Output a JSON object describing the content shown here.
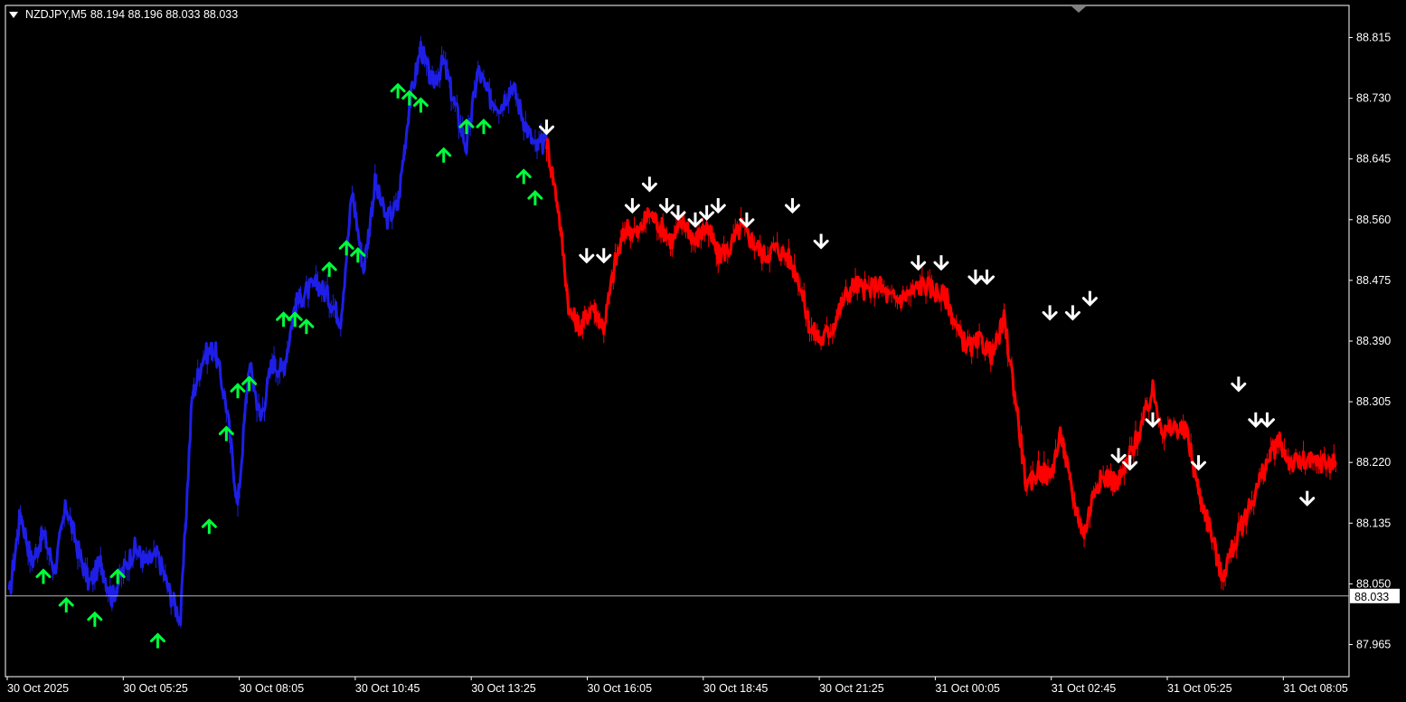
{
  "header": {
    "symbol": "NZDJPY,M5",
    "ohlc": "88.194 88.196 88.033 88.033"
  },
  "colors": {
    "background": "#000000",
    "axis": "#ffffff",
    "up_trend": "#1e1ee6",
    "down_trend": "#ff0000",
    "buy_arrow": "#00ff3c",
    "sell_arrow": "#ffffff",
    "price_line": "#b4b4b4"
  },
  "chart_data": {
    "type": "line",
    "ylim": [
      87.92,
      88.86
    ],
    "y_ticks": [
      "88.815",
      "88.730",
      "88.645",
      "88.560",
      "88.475",
      "88.390",
      "88.305",
      "88.220",
      "88.135",
      "88.050",
      "87.965"
    ],
    "x_ticks": [
      "30 Oct 2025",
      "30 Oct 05:25",
      "30 Oct 08:05",
      "30 Oct 10:45",
      "30 Oct 13:25",
      "30 Oct 16:05",
      "30 Oct 18:45",
      "30 Oct 21:25",
      "31 Oct 00:05",
      "31 Oct 02:45",
      "31 Oct 05:25",
      "31 Oct 08:05"
    ],
    "current_price": "88.033",
    "series": [
      {
        "trend": "up",
        "x": [
          0,
          0.1,
          0.2,
          0.3,
          0.4,
          0.5,
          0.6,
          0.7,
          0.8,
          0.9,
          1.0,
          1.1,
          1.2,
          1.3,
          1.4,
          1.5,
          1.6,
          1.7,
          1.8,
          1.9,
          2.0,
          2.1,
          2.2,
          2.3,
          2.4,
          2.5,
          2.6,
          2.7,
          2.8,
          2.9,
          3.0,
          3.1,
          3.2,
          3.3,
          3.4,
          3.5,
          3.6,
          3.7,
          3.8,
          3.9,
          4.0,
          4.1,
          4.2,
          4.3,
          4.4,
          4.5,
          4.6,
          4.7
        ],
        "values": [
          88.03,
          88.15,
          88.08,
          88.12,
          88.07,
          88.16,
          88.1,
          88.05,
          88.08,
          88.03,
          88.07,
          88.1,
          88.08,
          88.09,
          88.04,
          88.0,
          88.31,
          88.37,
          88.38,
          88.3,
          88.16,
          88.36,
          88.28,
          88.36,
          88.35,
          88.44,
          88.46,
          88.47,
          88.45,
          88.42,
          88.6,
          88.49,
          88.61,
          88.56,
          88.58,
          88.72,
          88.8,
          88.75,
          88.78,
          88.72,
          88.66,
          88.77,
          88.73,
          88.72,
          88.75,
          88.7,
          88.66,
          88.67
        ]
      },
      {
        "trend": "down",
        "x": [
          4.7,
          4.8,
          4.9,
          5.0,
          5.1,
          5.2,
          5.3,
          5.4,
          5.5,
          5.6,
          5.7,
          5.8,
          5.9,
          6.0,
          6.1,
          6.2,
          6.3,
          6.4,
          6.5,
          6.6,
          6.7,
          6.8,
          6.9,
          7.0,
          7.1,
          7.2,
          7.3,
          7.4,
          7.5,
          7.6,
          7.7,
          7.8,
          7.9,
          8.0,
          8.1,
          8.2,
          8.3,
          8.4,
          8.5,
          8.6,
          8.7,
          8.8,
          8.9,
          9.0,
          9.1,
          9.2,
          9.3,
          9.4,
          9.5,
          9.6,
          9.7,
          9.8,
          9.9,
          10.0,
          10.1,
          10.2,
          10.3,
          10.4,
          10.5,
          10.6,
          10.7,
          10.8,
          10.9,
          11.0,
          11.1,
          11.2,
          11.3,
          11.4,
          11.5,
          11.6
        ],
        "values": [
          88.67,
          88.58,
          88.43,
          88.41,
          88.44,
          88.41,
          88.5,
          88.55,
          88.54,
          88.57,
          88.55,
          88.53,
          88.56,
          88.53,
          88.55,
          88.51,
          88.52,
          88.55,
          88.53,
          88.51,
          88.52,
          88.51,
          88.48,
          88.41,
          88.39,
          88.41,
          88.45,
          88.47,
          88.46,
          88.47,
          88.45,
          88.45,
          88.46,
          88.47,
          88.46,
          88.45,
          88.4,
          88.38,
          88.39,
          88.37,
          88.42,
          88.31,
          88.18,
          88.21,
          88.2,
          88.26,
          88.17,
          88.12,
          88.19,
          88.2,
          88.19,
          88.23,
          88.27,
          88.32,
          88.26,
          88.27,
          88.26,
          88.18,
          88.13,
          88.06,
          88.1,
          88.14,
          88.18,
          88.22,
          88.25,
          88.22,
          88.22,
          88.22,
          88.22,
          88.22
        ]
      }
    ],
    "buy_signals": [
      {
        "x": 0.3,
        "y": 88.06
      },
      {
        "x": 0.5,
        "y": 88.02
      },
      {
        "x": 0.75,
        "y": 88.0
      },
      {
        "x": 0.95,
        "y": 88.06
      },
      {
        "x": 1.3,
        "y": 87.97
      },
      {
        "x": 1.75,
        "y": 88.13
      },
      {
        "x": 1.9,
        "y": 88.26
      },
      {
        "x": 2.0,
        "y": 88.32
      },
      {
        "x": 2.1,
        "y": 88.33
      },
      {
        "x": 2.4,
        "y": 88.42
      },
      {
        "x": 2.5,
        "y": 88.42
      },
      {
        "x": 2.6,
        "y": 88.41
      },
      {
        "x": 2.8,
        "y": 88.49
      },
      {
        "x": 2.95,
        "y": 88.52
      },
      {
        "x": 3.05,
        "y": 88.51
      },
      {
        "x": 3.4,
        "y": 88.74
      },
      {
        "x": 3.5,
        "y": 88.73
      },
      {
        "x": 3.6,
        "y": 88.72
      },
      {
        "x": 3.8,
        "y": 88.65
      },
      {
        "x": 4.0,
        "y": 88.69
      },
      {
        "x": 4.15,
        "y": 88.69
      },
      {
        "x": 4.5,
        "y": 88.62
      },
      {
        "x": 4.6,
        "y": 88.59
      }
    ],
    "sell_signals": [
      {
        "x": 4.7,
        "y": 88.69
      },
      {
        "x": 5.05,
        "y": 88.51
      },
      {
        "x": 5.2,
        "y": 88.51
      },
      {
        "x": 5.45,
        "y": 88.58
      },
      {
        "x": 5.6,
        "y": 88.61
      },
      {
        "x": 5.75,
        "y": 88.58
      },
      {
        "x": 5.85,
        "y": 88.57
      },
      {
        "x": 6.0,
        "y": 88.56
      },
      {
        "x": 6.1,
        "y": 88.57
      },
      {
        "x": 6.2,
        "y": 88.58
      },
      {
        "x": 6.45,
        "y": 88.56
      },
      {
        "x": 6.85,
        "y": 88.58
      },
      {
        "x": 7.1,
        "y": 88.53
      },
      {
        "x": 7.95,
        "y": 88.5
      },
      {
        "x": 8.15,
        "y": 88.5
      },
      {
        "x": 8.45,
        "y": 88.48
      },
      {
        "x": 8.55,
        "y": 88.48
      },
      {
        "x": 9.1,
        "y": 88.43
      },
      {
        "x": 9.3,
        "y": 88.43
      },
      {
        "x": 9.45,
        "y": 88.45
      },
      {
        "x": 9.7,
        "y": 88.23
      },
      {
        "x": 9.8,
        "y": 88.22
      },
      {
        "x": 10.0,
        "y": 88.28
      },
      {
        "x": 10.4,
        "y": 88.22
      },
      {
        "x": 10.75,
        "y": 88.33
      },
      {
        "x": 10.9,
        "y": 88.28
      },
      {
        "x": 11.0,
        "y": 88.28
      },
      {
        "x": 11.35,
        "y": 88.17
      }
    ]
  }
}
